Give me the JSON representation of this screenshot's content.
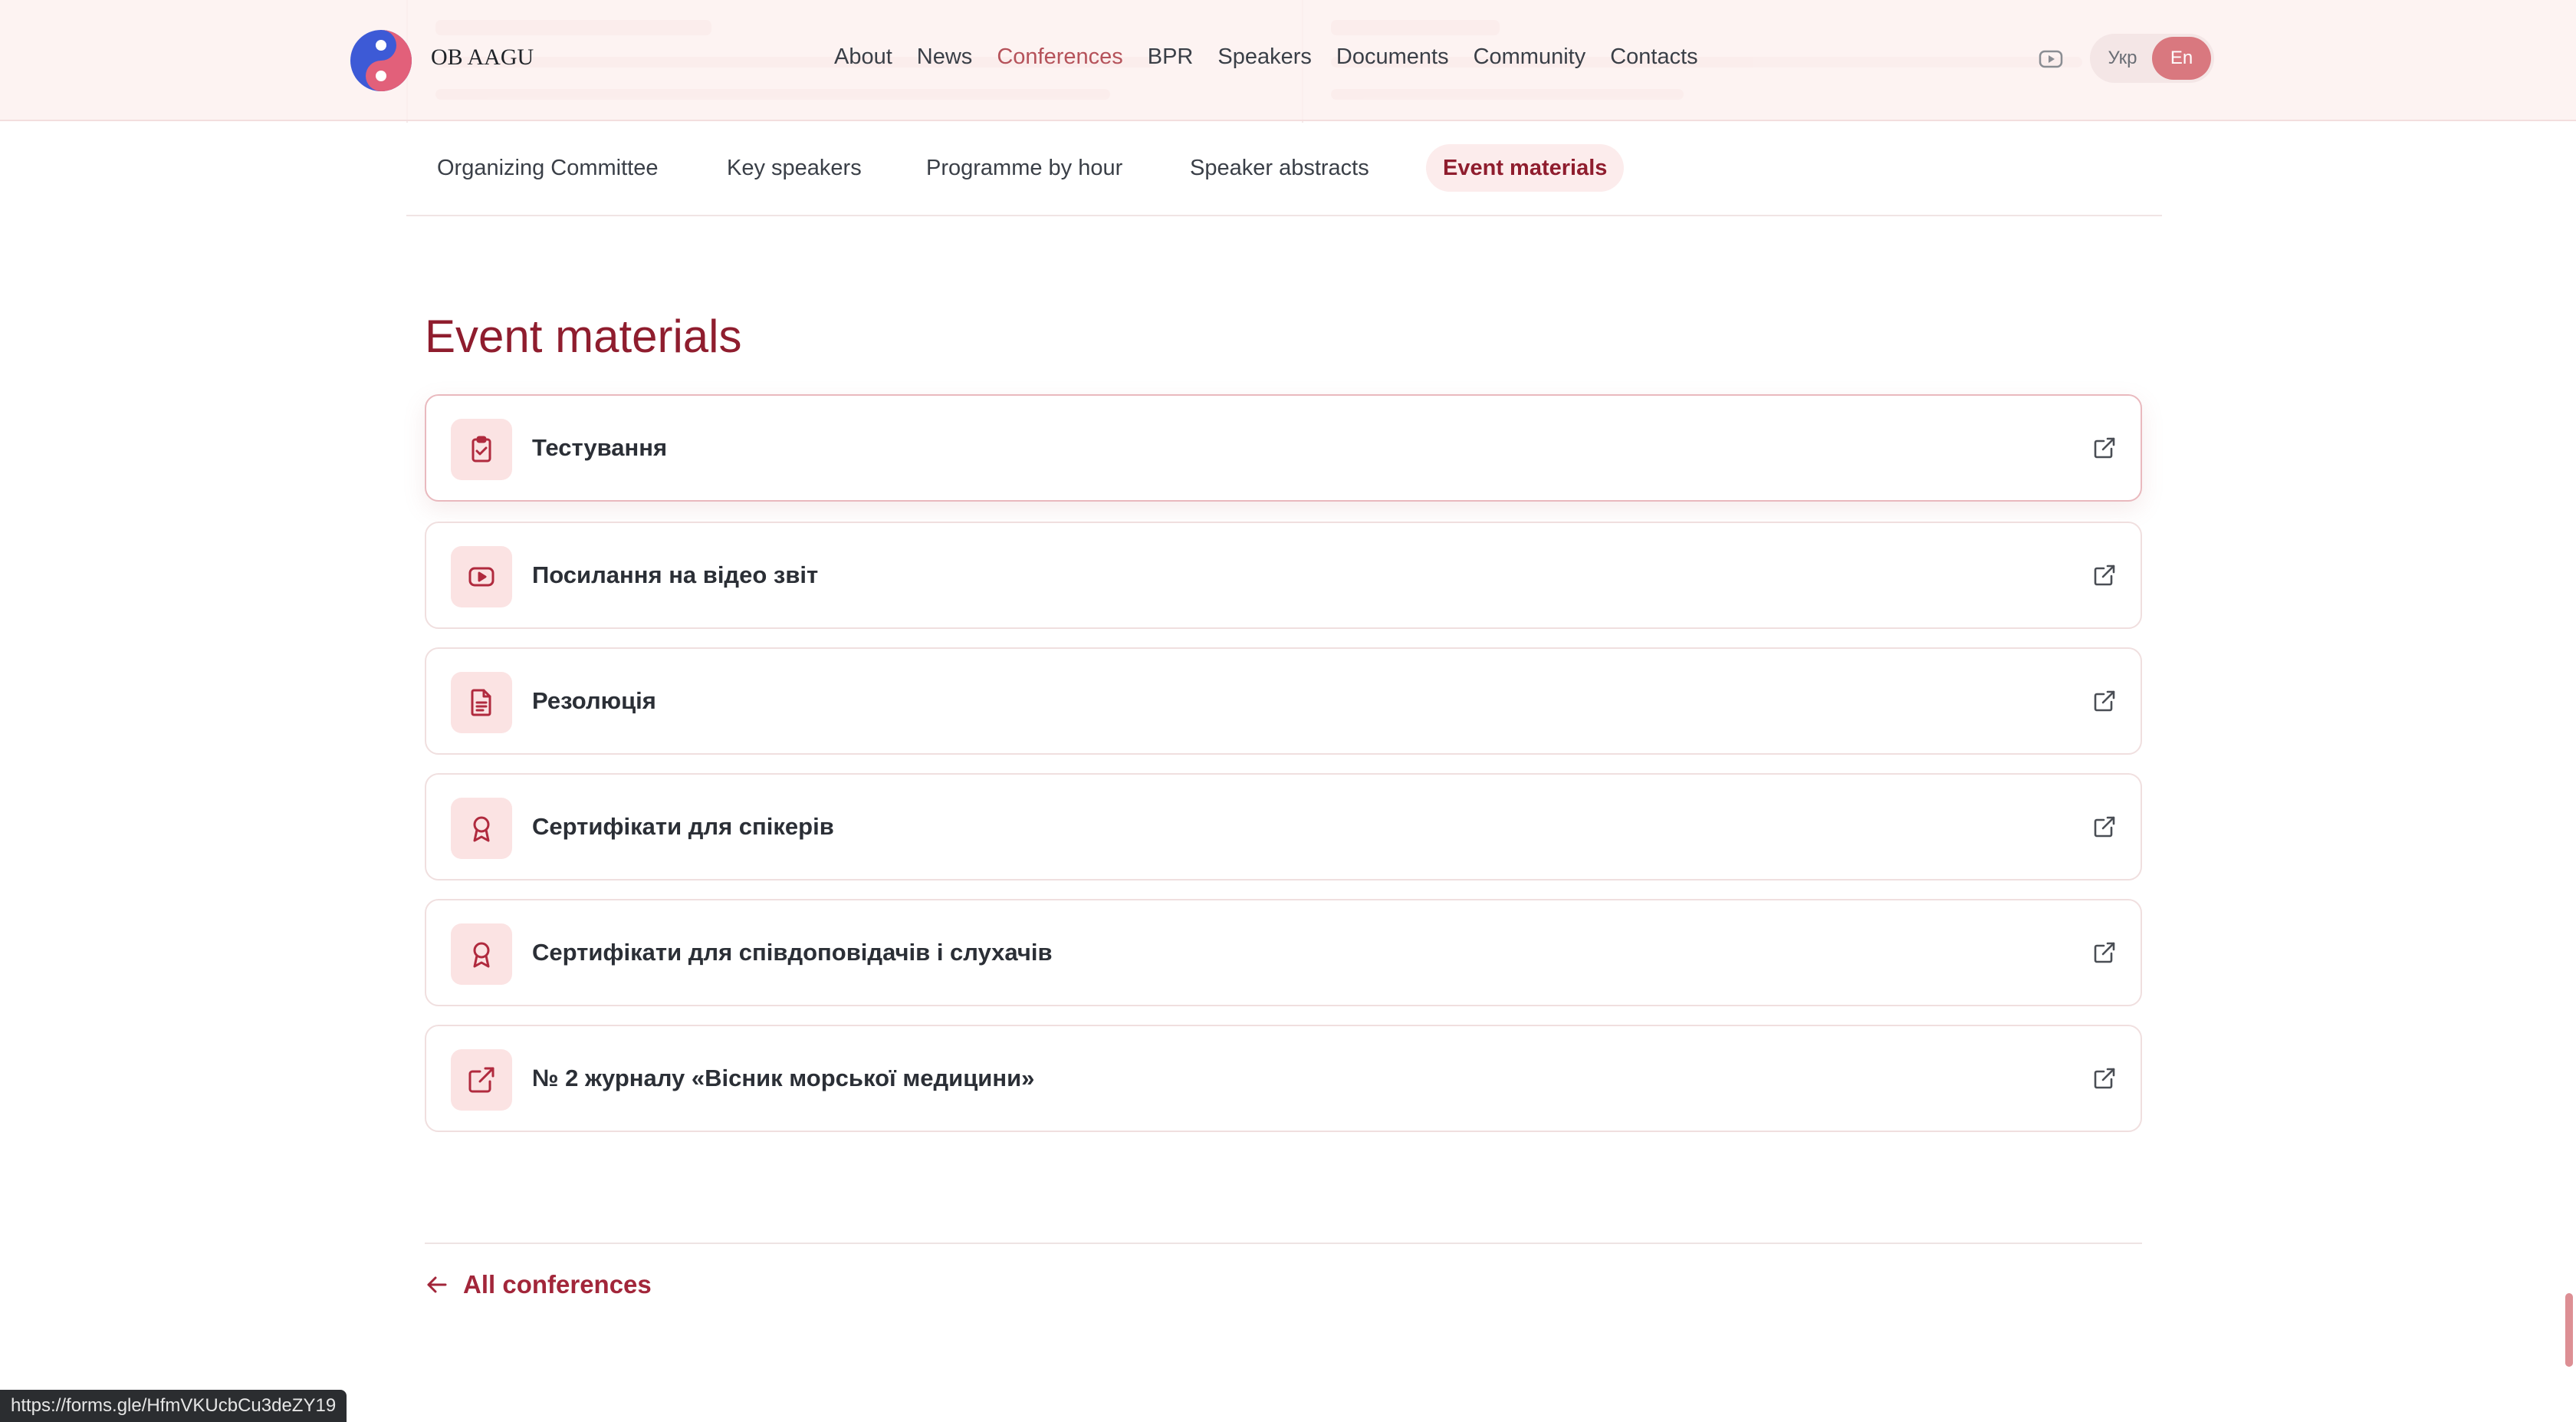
{
  "header": {
    "brand": "OB AAGU",
    "nav": [
      {
        "label": "About",
        "active": false
      },
      {
        "label": "News",
        "active": false
      },
      {
        "label": "Conferences",
        "active": true
      },
      {
        "label": "BPR",
        "active": false
      },
      {
        "label": "Speakers",
        "active": false
      },
      {
        "label": "Documents",
        "active": false
      },
      {
        "label": "Community",
        "active": false
      },
      {
        "label": "Contacts",
        "active": false
      }
    ],
    "youtube_icon": "youtube-icon",
    "languages": [
      {
        "label": "Укр",
        "active": false
      },
      {
        "label": "En",
        "active": true
      }
    ]
  },
  "subnav": [
    {
      "label": "Organizing Committee",
      "active": false
    },
    {
      "label": "Key speakers",
      "active": false
    },
    {
      "label": "Programme by hour",
      "active": false
    },
    {
      "label": "Speaker abstracts",
      "active": false
    },
    {
      "label": "Event materials",
      "active": true
    }
  ],
  "main": {
    "title": "Event materials",
    "materials": [
      {
        "label": "Тестування",
        "icon": "clipboard-check-icon"
      },
      {
        "label": "Посилання на відео звіт",
        "icon": "youtube-icon"
      },
      {
        "label": "Резолюція",
        "icon": "document-icon"
      },
      {
        "label": "Сертифікати для спікерів",
        "icon": "award-icon"
      },
      {
        "label": "Сертифікати для співдоповідачів і слухачів",
        "icon": "award-icon"
      },
      {
        "label": "№ 2 журналу «Вісник морської медицини»",
        "icon": "external-link-icon"
      }
    ],
    "back_link": "All conferences"
  },
  "status_bar": {
    "url": "https://forms.gle/HfmVKUcbCu3deZY19"
  },
  "colors": {
    "accent": "#8f1d2e",
    "active_nav": "#b5525a",
    "icon_bg": "#fbe3e3",
    "lang_active": "#d9787f"
  }
}
